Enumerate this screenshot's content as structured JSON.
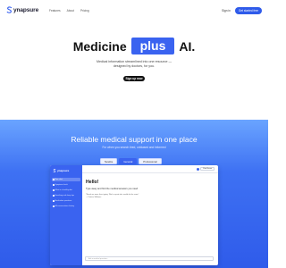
{
  "nav": {
    "brand": "ynapsure",
    "links": [
      "Features",
      "About",
      "Pricing"
    ],
    "signin": "Sign in",
    "cta": "Get started free"
  },
  "hero": {
    "title_left": "Medicine",
    "title_pill": "plus",
    "title_right": "AI.",
    "subtitle_line1": "Medical information streamlined into one resource —",
    "subtitle_line2": "designed by doctors, for you.",
    "signup": "Sign up now"
  },
  "section": {
    "title": "Reliable medical support in one place",
    "subtitle": "For when you search tired, unbiased and informed",
    "tabs": [
      "Newbie",
      "General",
      "Professional"
    ],
    "active_tab": 1
  },
  "app": {
    "brand": "ynapsure",
    "sidebar_items": [
      "New chat",
      "Symptom check",
      "What is a healthy diet",
      "Breathing and sleep tips",
      "Medication questions",
      "All conversations history"
    ],
    "user_name": "Chat Name",
    "greeting": "Hello!",
    "message": "Type away and find the medical answers you need",
    "quote_line1": "\"Needs no more than typing. Wish a quote doc would do the same\"",
    "quote_line2": "— Patricia Williams",
    "input_placeholder": "Ask a medical question..."
  },
  "colors": {
    "accent": "#3a63f0",
    "cta": "#2f5bea",
    "dark_button": "#111111"
  }
}
